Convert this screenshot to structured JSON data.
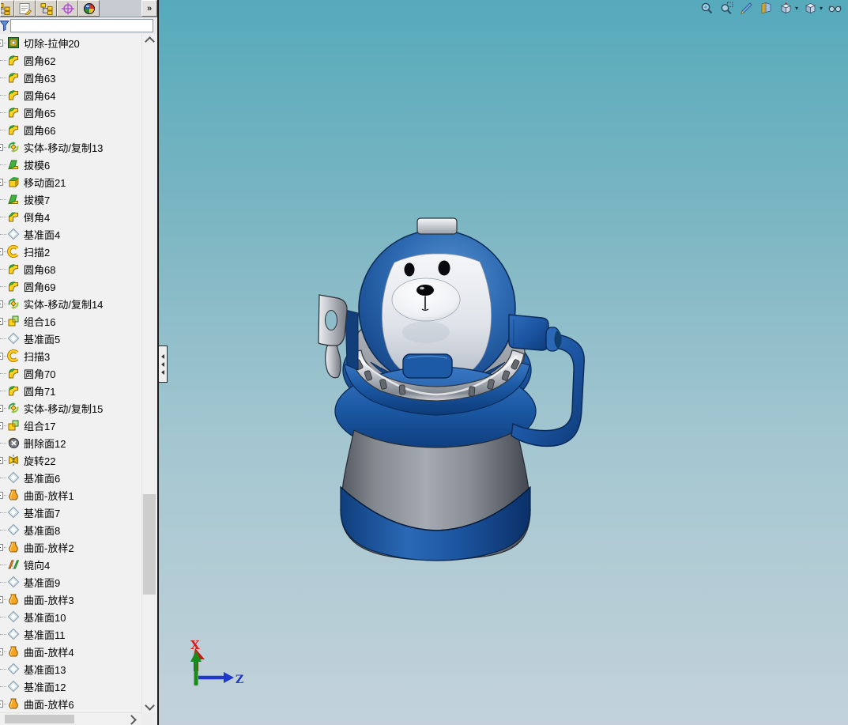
{
  "panel": {
    "tabs": [
      {
        "name": "featuremanager-tree-tab"
      },
      {
        "name": "propertymanager-tab"
      },
      {
        "name": "configurationmanager-tab"
      },
      {
        "name": "dimxpertmanager-tab"
      },
      {
        "name": "displaymanager-tab"
      }
    ],
    "overflow_label": "»",
    "filter": {
      "value": "",
      "placeholder": ""
    },
    "tree_items": [
      {
        "label": "切除-拉伸20",
        "icon": "cut-extrude",
        "expandable": true
      },
      {
        "label": "圆角62",
        "icon": "fillet",
        "expandable": false
      },
      {
        "label": "圆角63",
        "icon": "fillet",
        "expandable": false
      },
      {
        "label": "圆角64",
        "icon": "fillet",
        "expandable": false
      },
      {
        "label": "圆角65",
        "icon": "fillet",
        "expandable": false
      },
      {
        "label": "圆角66",
        "icon": "fillet",
        "expandable": false
      },
      {
        "label": "实体-移动/复制13",
        "icon": "move-copy",
        "expandable": true
      },
      {
        "label": "拔模6",
        "icon": "draft",
        "expandable": false
      },
      {
        "label": "移动面21",
        "icon": "move-face",
        "expandable": true
      },
      {
        "label": "拔模7",
        "icon": "draft",
        "expandable": false
      },
      {
        "label": "倒角4",
        "icon": "chamfer",
        "expandable": false
      },
      {
        "label": "基准面4",
        "icon": "plane",
        "expandable": false
      },
      {
        "label": "扫描2",
        "icon": "sweep",
        "expandable": true
      },
      {
        "label": "圆角68",
        "icon": "fillet",
        "expandable": false
      },
      {
        "label": "圆角69",
        "icon": "fillet",
        "expandable": false
      },
      {
        "label": "实体-移动/复制14",
        "icon": "move-copy",
        "expandable": true
      },
      {
        "label": "组合16",
        "icon": "combine",
        "expandable": true
      },
      {
        "label": "基准面5",
        "icon": "plane",
        "expandable": false
      },
      {
        "label": "扫描3",
        "icon": "sweep",
        "expandable": true
      },
      {
        "label": "圆角70",
        "icon": "fillet",
        "expandable": false
      },
      {
        "label": "圆角71",
        "icon": "fillet",
        "expandable": false
      },
      {
        "label": "实体-移动/复制15",
        "icon": "move-copy",
        "expandable": true
      },
      {
        "label": "组合17",
        "icon": "combine",
        "expandable": true
      },
      {
        "label": "删除面12",
        "icon": "delete-face",
        "expandable": false
      },
      {
        "label": "旋转22",
        "icon": "revolve",
        "expandable": true
      },
      {
        "label": "基准面6",
        "icon": "plane",
        "expandable": false
      },
      {
        "label": "曲面-放样1",
        "icon": "surface-loft",
        "expandable": true
      },
      {
        "label": "基准面7",
        "icon": "plane",
        "expandable": false
      },
      {
        "label": "基准面8",
        "icon": "plane",
        "expandable": false
      },
      {
        "label": "曲面-放样2",
        "icon": "surface-loft",
        "expandable": true
      },
      {
        "label": "镜向4",
        "icon": "mirror",
        "expandable": false
      },
      {
        "label": "基准面9",
        "icon": "plane",
        "expandable": false
      },
      {
        "label": "曲面-放样3",
        "icon": "surface-loft",
        "expandable": true
      },
      {
        "label": "基准面10",
        "icon": "plane",
        "expandable": false
      },
      {
        "label": "基准面11",
        "icon": "plane",
        "expandable": false
      },
      {
        "label": "曲面-放样4",
        "icon": "surface-loft",
        "expandable": true
      },
      {
        "label": "基准面13",
        "icon": "plane",
        "expandable": false
      },
      {
        "label": "基准面12",
        "icon": "plane",
        "expandable": false
      },
      {
        "label": "曲面-放样6",
        "icon": "surface-loft",
        "expandable": true
      }
    ]
  },
  "headsup": {
    "dropdown_glyph": "▾",
    "buttons": [
      {
        "name": "zoom-to-fit"
      },
      {
        "name": "zoom-to-area"
      },
      {
        "name": "previous-view"
      },
      {
        "name": "section-view"
      },
      {
        "name": "view-orientation",
        "dropdown": true
      },
      {
        "name": "display-style",
        "dropdown": true
      },
      {
        "name": "hide-show-items"
      }
    ]
  },
  "viewport": {
    "triad": {
      "x_label": "X",
      "z_label": "Z"
    }
  },
  "colors": {
    "background_top": "#55aabb",
    "background_bottom": "#c3d2da",
    "model_blue": "#1c55a0",
    "model_gray": "#8b8f97",
    "model_silver": "#c9ccd1"
  }
}
